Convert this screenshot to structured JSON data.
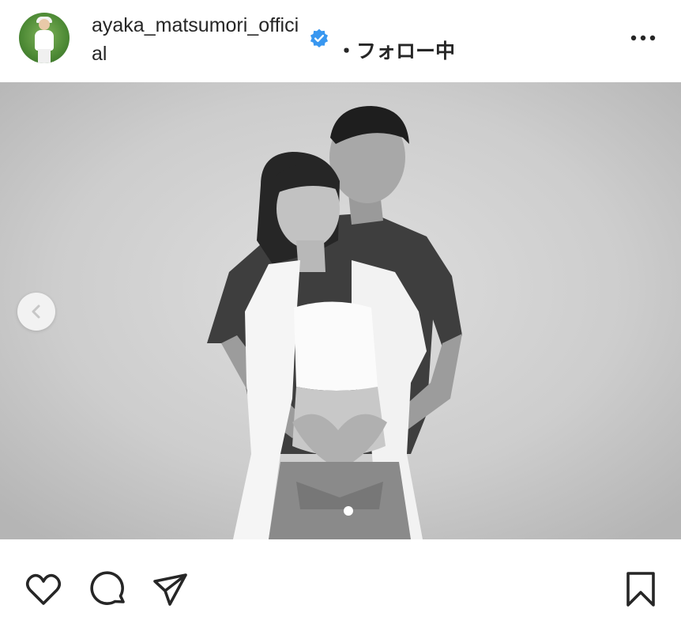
{
  "post": {
    "username": "ayaka_matsumori_official",
    "verified_icon": "verified-badge-icon",
    "separator": "・",
    "follow_label": "フォロー中",
    "more_icon": "more-options-icon",
    "colors": {
      "verified": "#3897f0",
      "text": "#262626"
    }
  },
  "carousel": {
    "prev_icon": "chevron-left-icon",
    "photo_alt": "maternity photo",
    "current_slide": 1
  },
  "actions": {
    "like_icon": "heart-icon",
    "comment_icon": "comment-icon",
    "share_icon": "send-icon",
    "save_icon": "bookmark-icon"
  }
}
